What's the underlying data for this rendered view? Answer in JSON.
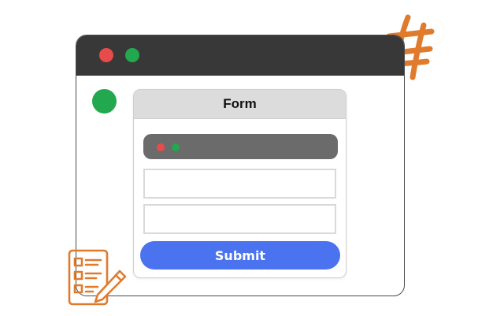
{
  "colors": {
    "accent_orange": "#e07b2d",
    "traffic_red": "#e84b4b",
    "traffic_green": "#22a84f",
    "titlebar": "#383838",
    "submit_blue": "#4b73f0"
  },
  "icons": {
    "hash_decoration": "hash-icon",
    "checklist": "checklist-pencil-icon"
  },
  "form": {
    "title": "Form",
    "fields": [
      {
        "value": "",
        "placeholder": ""
      },
      {
        "value": "",
        "placeholder": ""
      }
    ],
    "submit_label": "Submit"
  }
}
